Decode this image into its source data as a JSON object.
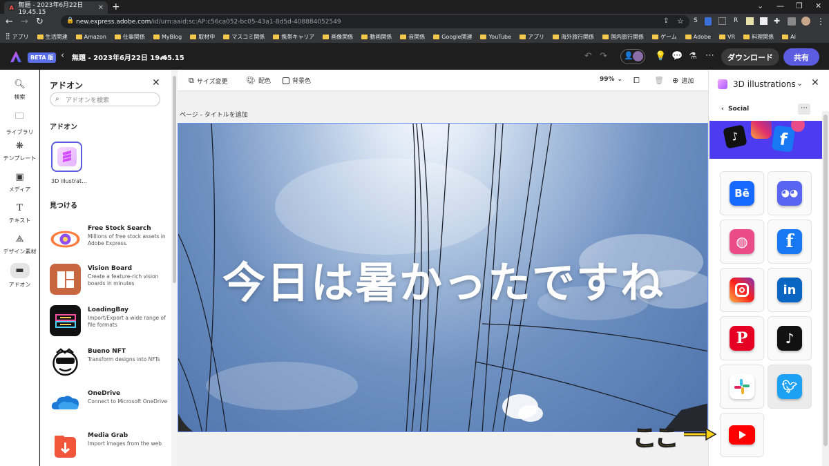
{
  "browser": {
    "tab_title": "無題 - 2023年6月22日 19.45.15",
    "url_host": "new.express.adobe.com",
    "url_path": "/id/urn:aaid:sc:AP:c56ca052-bc05-43a1-8d5d-408884052549",
    "bookmarks": [
      "アプリ",
      "生活関連",
      "Amazon",
      "仕事関係",
      "MyBlog",
      "取材中",
      "マスコミ関係",
      "携帯キャリア",
      "画像関係",
      "動画関係",
      "音関係",
      "Google関連",
      "YouTube",
      "アプリ",
      "海外旅行関係",
      "国内旅行関係",
      "ゲーム",
      "Adobe",
      "VR",
      "料理関係",
      "AI"
    ]
  },
  "app": {
    "beta_badge": "BETA 版",
    "doc_title": "無題 - 2023年6月22日 19.45.15",
    "download_label": "ダウンロード",
    "share_label": "共有"
  },
  "rail": {
    "items": [
      {
        "label": "検索",
        "icon": "search-icon"
      },
      {
        "label": "ライブラリ",
        "icon": "folder-icon"
      },
      {
        "label": "テンプレート",
        "icon": "template-icon"
      },
      {
        "label": "メディア",
        "icon": "media-icon"
      },
      {
        "label": "テキスト",
        "icon": "text-icon"
      },
      {
        "label": "デザイン素材",
        "icon": "shapes-icon"
      },
      {
        "label": "アドオン",
        "icon": "addon-icon"
      }
    ]
  },
  "addons": {
    "title": "アドオン",
    "search_placeholder": "アドオンを検索",
    "section_installed": "アドオン",
    "installed_label": "3D illustrat…",
    "section_discover": "見つける",
    "list": [
      {
        "name": "Free Stock Search",
        "desc": "Millions of free stock assets in Adobe Express."
      },
      {
        "name": "Vision Board",
        "desc": "Create a feature-rich vision boards in minutes"
      },
      {
        "name": "LoadingBay",
        "desc": "Import/Export a wide range of file formats"
      },
      {
        "name": "Bueno NFT",
        "desc": "Transform designs into NFTs"
      },
      {
        "name": "OneDrive",
        "desc": "Connect to Microsoft OneDrive"
      },
      {
        "name": "Media Grab",
        "desc": "Import images from the web"
      }
    ]
  },
  "toolbar": {
    "resize": "サイズ変更",
    "color": "配色",
    "background": "背景色",
    "zoom": "99%",
    "add": "追加"
  },
  "canvas": {
    "page_label": "ページ - タイトルを追加",
    "headline": "今日は暑かったですね"
  },
  "right_panel": {
    "title": "3D illustrations",
    "back_label": "Social",
    "tiles": [
      "behance",
      "discord",
      "dribbble",
      "facebook",
      "instagram",
      "linkedin",
      "pinterest",
      "tiktok",
      "slack",
      "twitter",
      "youtube"
    ]
  },
  "annotation": "ここ"
}
